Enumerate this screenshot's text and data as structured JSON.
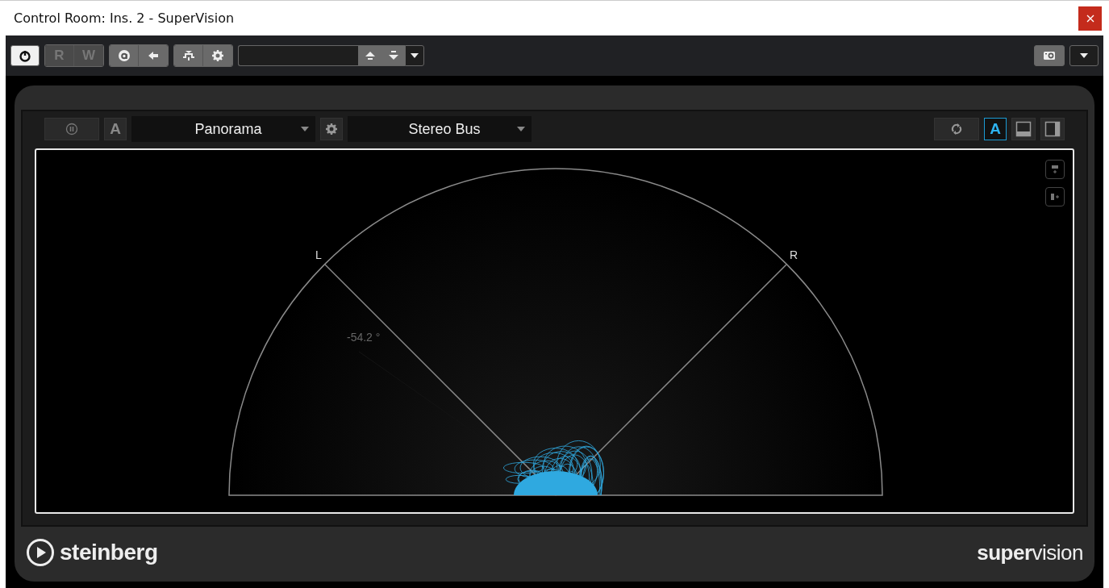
{
  "window": {
    "title": "Control Room: Ins. 2 - SuperVision"
  },
  "toolbar": {
    "left": [
      [
        {
          "kind": "power",
          "on": true,
          "disabled": false
        }
      ],
      [
        {
          "kind": "read",
          "label": "R",
          "disabled": true
        },
        {
          "kind": "write",
          "label": "W",
          "disabled": true
        }
      ],
      [
        {
          "kind": "auto",
          "disabled": false
        },
        {
          "kind": "back",
          "disabled": false
        }
      ],
      [
        {
          "kind": "bypass",
          "disabled": false
        },
        {
          "kind": "gear",
          "disabled": false
        }
      ]
    ],
    "right": [
      {
        "kind": "camera",
        "disabled": false
      }
    ]
  },
  "plugin": {
    "toolbar": {
      "left": [
        {
          "kind": "pause",
          "on": false
        },
        {
          "kind": "auto",
          "label": "A",
          "on": false
        }
      ],
      "module": {
        "value": "Panorama"
      },
      "bus": {
        "value": "Stereo Bus"
      },
      "right": [
        {
          "kind": "sync",
          "on": false
        },
        {
          "kind": "auto",
          "label": "A",
          "on": true
        },
        {
          "kind": "layout-bottom",
          "on": false
        },
        {
          "kind": "layout-right",
          "on": false
        }
      ]
    },
    "display": {
      "left_label": "L",
      "right_label": "R",
      "angle_reading": "-54.2 °"
    },
    "footer": {
      "brand": "steinberg",
      "product": "**super**vision"
    }
  }
}
